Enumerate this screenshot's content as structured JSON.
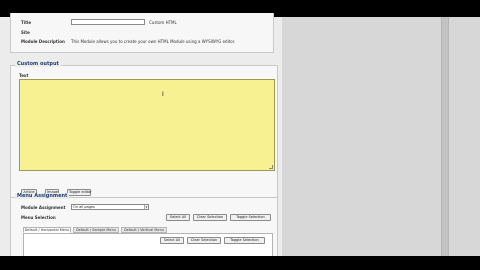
{
  "module": {
    "title_label": "Title",
    "title_value": "",
    "title_suffix": "Custom HTML",
    "site_label": "Site",
    "description_label": "Module Description",
    "description_text": "This Module allows you to create your own HTML Module using a WYSIWYG editor."
  },
  "custom_output": {
    "legend": "Custom output",
    "text_label": "Text",
    "editor_content": "",
    "cursor_glyph": "I",
    "buttons": [
      "Article",
      "Image",
      "Toggle editor"
    ]
  },
  "menu_assignment": {
    "legend": "Menu Assignment",
    "module_assignment_label": "Module Assignment",
    "module_assignment_value": "On all pages",
    "menu_selection_label": "Menu Selection",
    "buttons": [
      "Select All",
      "Clear Selection",
      "Toggle Selection"
    ],
    "tabs": [
      "Default / Horizontal Menu",
      "Default / Sample Menu",
      "Default / Vertical Menu"
    ],
    "tab_buttons": [
      "Select All",
      "Clear Selection",
      "Toggle Selection"
    ]
  },
  "icons": {
    "dropdown": "chevron-down-icon",
    "text_cursor": "text-cursor-icon",
    "resize": "resize-grip-icon"
  },
  "colors": {
    "editor_bg": "#f7f191",
    "legend_text": "#1f3f6e",
    "side_panel": "#d7d7d7"
  }
}
